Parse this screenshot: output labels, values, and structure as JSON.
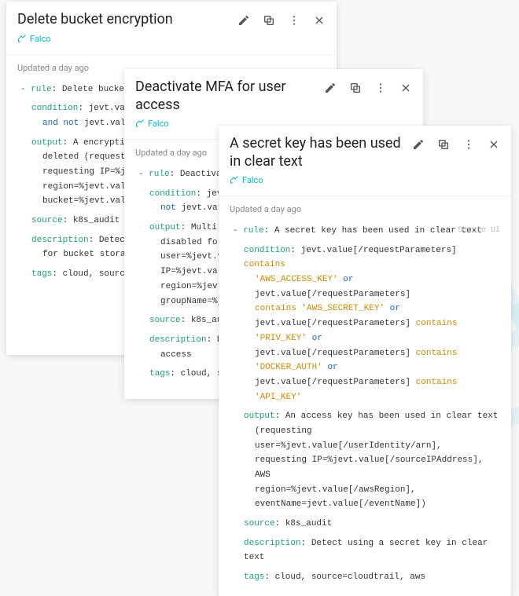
{
  "brand": "Falco",
  "updated": "Updated a day ago",
  "secure_tag": "Secure UI",
  "cards": [
    {
      "title": "Delete bucket encryption",
      "code": {
        "rule": "Delete bucke",
        "condition_l1": "jevt.va",
        "condition_l2": "jevt.val",
        "output_l1": "A encryption",
        "output_l2": "deleted (request",
        "output_l3": "requesting IP=%j",
        "output_l4": "region=%jevt.val",
        "output_l5": "bucket=%jevt.val",
        "source": "k8s_audit",
        "description_l1": "Detec",
        "description_l2": "for bucket stora",
        "tags": "cloud, sourc"
      }
    },
    {
      "title": "Deactivate MFA for user access",
      "code": {
        "rule": "Deactivate M",
        "condition_l1": "jevt.va",
        "condition_l2": "jevt.value[/",
        "output_l1": "Multi Fact",
        "output_l2": "disabled for a u",
        "output_l3": "user=%jevt.value",
        "output_l4": "IP=%jevt.value[/",
        "output_l5": "region=%jevt.val",
        "output_l6": "groupName=%jevt.",
        "source": "k8s_audit",
        "description_l1": "Detec",
        "description_l2": "access",
        "tags": "cloud, sour"
      }
    },
    {
      "title": "A secret key has been used in clear text",
      "code": {
        "rule": "A secret key has been used in clear text",
        "cond_a": "jevt.value[/requestParameters]",
        "cond_b": "'AWS_ACCESS_KEY'",
        "cond_c": "jevt.value[/requestParameters]",
        "cond_d": "'AWS_SECRET_KEY'",
        "cond_e": "jevt.value[/requestParameters]",
        "cond_f": "'PRIV_KEY'",
        "cond_g": "jevt.value[/requestParameters]",
        "cond_h": "'DOCKER_AUTH'",
        "cond_i": "jevt.value[/requestParameters]",
        "cond_j": "'API_KEY'",
        "out_l1": "An access key has been used in clear text",
        "out_l2": "(requesting user=%jevt.value[/userIdentity/arn],",
        "out_l3": "requesting IP=%jevt.value[/sourceIPAddress], AWS",
        "out_l4": "region=%jevt.value[/awsRegion],",
        "out_l5": "eventName=jevt.value[/eventName])",
        "source": "k8s_audit",
        "description": "Detect using a secret key in clear text",
        "tags": "cloud, source=cloudtrail, aws",
        "kw_contains": "contains",
        "kw_or": "or",
        "kw_and_not": "and not",
        "kw_not": "not"
      }
    }
  ],
  "keys": {
    "rule": "rule",
    "condition": "condition",
    "output": "output",
    "source": "source",
    "description": "description",
    "tags": "tags"
  }
}
